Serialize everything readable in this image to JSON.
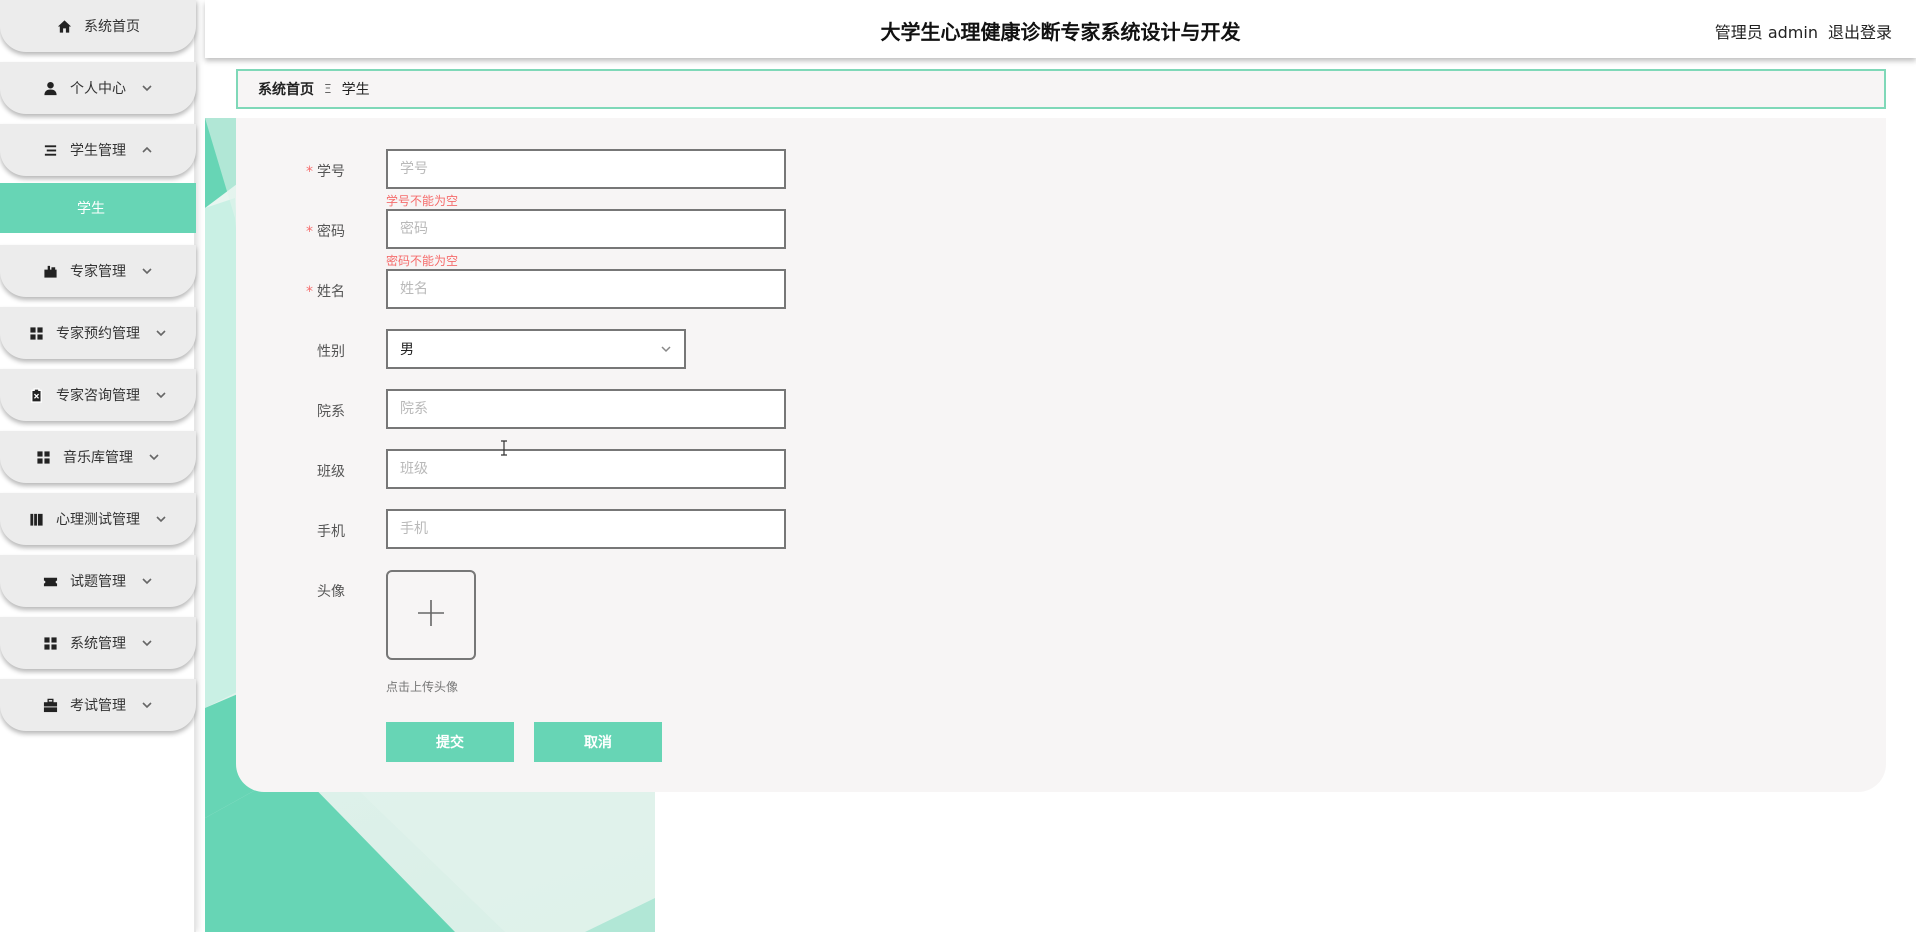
{
  "header": {
    "title": "大学生心理健康诊断专家系统设计与开发",
    "user_label": "管理员 admin",
    "logout_label": "退出登录"
  },
  "sidebar": {
    "items": [
      {
        "label": "系统首页",
        "icon": "home-icon"
      },
      {
        "label": "个人中心",
        "icon": "user-icon"
      },
      {
        "label": "学生管理",
        "icon": "list-icon"
      },
      {
        "label": "专家管理",
        "icon": "briefcase-icon"
      },
      {
        "label": "专家预约管理",
        "icon": "grid-icon"
      },
      {
        "label": "专家咨询管理",
        "icon": "clipboard-icon"
      },
      {
        "label": "音乐库管理",
        "icon": "grid-icon"
      },
      {
        "label": "心理测试管理",
        "icon": "book-icon"
      },
      {
        "label": "试题管理",
        "icon": "ticket-icon"
      },
      {
        "label": "系统管理",
        "icon": "grid-icon"
      },
      {
        "label": "考试管理",
        "icon": "toolbox-icon"
      }
    ],
    "submenu": {
      "label": "学生"
    }
  },
  "breadcrumb": {
    "home": "系统首页",
    "separator": "Ξ",
    "current": "学生"
  },
  "form": {
    "student_id": {
      "label": "学号",
      "placeholder": "学号",
      "error": "学号不能为空"
    },
    "password": {
      "label": "密码",
      "placeholder": "密码",
      "error": "密码不能为空"
    },
    "name": {
      "label": "姓名",
      "placeholder": "姓名"
    },
    "gender": {
      "label": "性别",
      "value": "男"
    },
    "department": {
      "label": "院系",
      "placeholder": "院系"
    },
    "class": {
      "label": "班级",
      "placeholder": "班级"
    },
    "phone": {
      "label": "手机",
      "placeholder": "手机"
    },
    "avatar": {
      "label": "头像",
      "tip": "点击上传头像"
    },
    "required_mark": "*",
    "submit_label": "提交",
    "cancel_label": "取消"
  },
  "colors": {
    "accent": "#67d5b5",
    "error": "#f56c6c",
    "panel_bg": "#f7f5f5"
  }
}
